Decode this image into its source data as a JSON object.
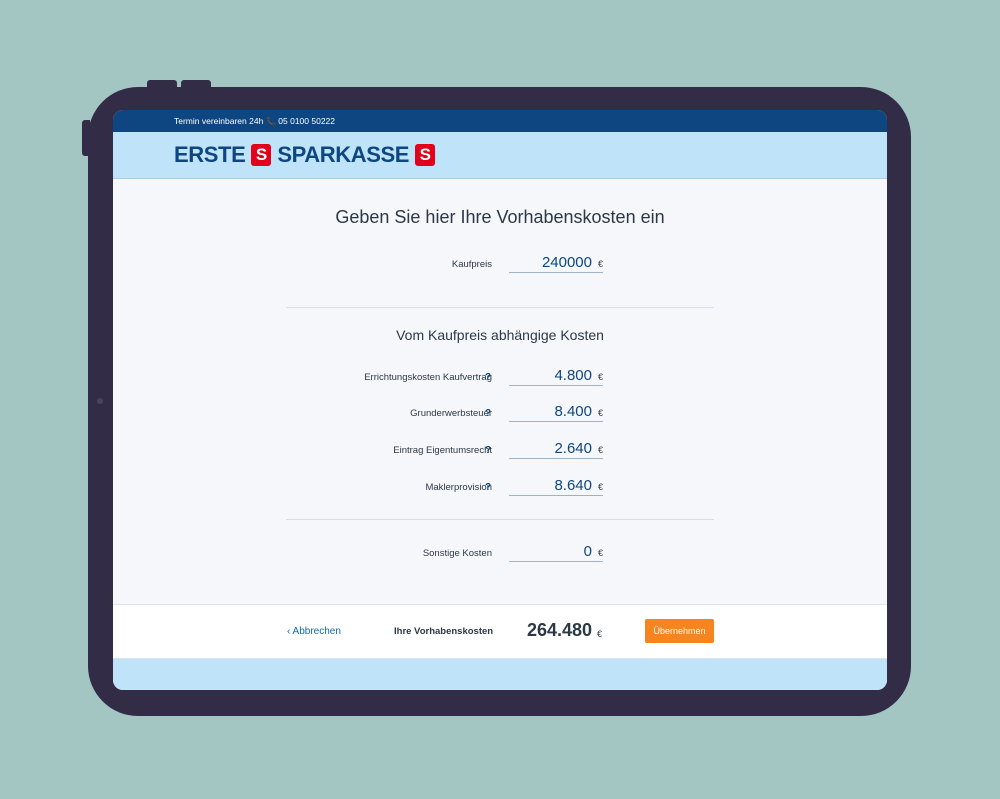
{
  "topbar": {
    "appointment_text": "Termin vereinbaren 24h",
    "phone": "05 0100 50222"
  },
  "logo": {
    "left": "ERSTE",
    "right": "SPARKASSE",
    "s_symbol": "S"
  },
  "main": {
    "title": "Geben Sie hier Ihre Vorhabenskosten ein",
    "kaufpreis": {
      "label": "Kaufpreis",
      "value": "240000",
      "currency": "€"
    },
    "section_title": "Vom Kaufpreis abhängige Kosten",
    "costs": [
      {
        "label": "Errichtungskosten Kaufvertrag",
        "help": "?",
        "value": "4.800",
        "currency": "€"
      },
      {
        "label": "Grunderwerbsteuer",
        "help": "?",
        "value": "8.400",
        "currency": "€"
      },
      {
        "label": "Eintrag Eigentumsrecht",
        "help": "?",
        "value": "2.640",
        "currency": "€"
      },
      {
        "label": "Maklerprovision",
        "help": "?",
        "value": "8.640",
        "currency": "€"
      }
    ],
    "sonstige": {
      "label": "Sonstige Kosten",
      "value": "0",
      "currency": "€"
    }
  },
  "footer": {
    "back_label": "‹ Abbrechen",
    "total_label": "Ihre Vorhabenskosten",
    "total_value": "264.480",
    "total_currency": "€",
    "submit_label": "Übernehmen"
  },
  "colors": {
    "brand_blue": "#0d4680",
    "light_blue": "#bfe3f8",
    "accent_orange": "#f6851f",
    "logo_red": "#e3001b",
    "background": "#a3c6c3",
    "frame": "#332c47"
  }
}
